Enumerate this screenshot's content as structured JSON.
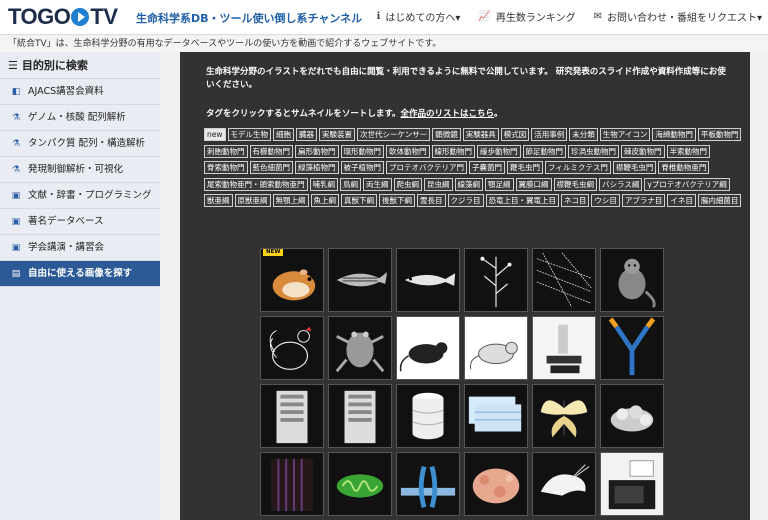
{
  "header": {
    "logo_left": "TOGO",
    "logo_right": "TV",
    "tagline": "生命科学系DB・ツール使い倒し系チャンネル",
    "nav": [
      {
        "icon": "info-icon",
        "label": "はじめての方へ▾"
      },
      {
        "icon": "chart-icon",
        "label": "再生数ランキング"
      },
      {
        "icon": "mail-icon",
        "label": "お問い合わせ・番組をリクエスト▾"
      }
    ]
  },
  "infobar": "「統合TV」は、生命科学分野の有用なデータベースやツールの使い方を動画で紹介するウェブサイトです。",
  "sidebar": {
    "heading": "目的別に検索",
    "items": [
      {
        "icon": "bookmark-icon",
        "label": "AJACS講習会資料"
      },
      {
        "icon": "flask-icon",
        "label": "ゲノム・核酸 配列解析"
      },
      {
        "icon": "flask-icon",
        "label": "タンパク質 配列・構造解析"
      },
      {
        "icon": "flask-icon",
        "label": "発現制御解析・可視化"
      },
      {
        "icon": "book-icon",
        "label": "文献・辞書・プログラミング"
      },
      {
        "icon": "book-icon",
        "label": "著名データベース"
      },
      {
        "icon": "book-icon",
        "label": "学会講演・講習会"
      },
      {
        "icon": "image-icon",
        "label": "自由に使える画像を探す"
      }
    ]
  },
  "main": {
    "intro": "生命科学分野のイラストをだれでも自由に閲覧・利用できるように無料で公開しています。 研究発表のスライド作成や資料作成等にお使いください。",
    "hint_text": "タグをクリックするとサムネイルをソートします。",
    "hint_link": "全作品のリストはこちら",
    "hint_end": "。",
    "tags": [
      "new",
      "モデル生物",
      "細胞",
      "臓器",
      "実験装置",
      "次世代シーケンサー",
      "顕微鏡",
      "実験器具",
      "模式図",
      "活用事例",
      "未分類",
      "生物アイコン",
      "海綿動物門",
      "平板動物門",
      "刺胞動物門",
      "有櫛動物門",
      "扁形動物門",
      "環形動物門",
      "軟体動物門",
      "線形動物門",
      "緩歩動物門",
      "節足動物門",
      "珍渦虫動物門",
      "棘皮動物門",
      "半索動物門",
      "脊索動物門",
      "藍色細菌門",
      "緑藻植物門",
      "被子植物門",
      "プロテオバクテリア門",
      "子嚢菌門",
      "鞭毛虫門",
      "フィルミクテス門",
      "襟鞭毛虫門",
      "脊椎動物亜門",
      "尾索動物亜門・頭索動物亜門",
      "哺乳綱",
      "鳥綱",
      "両生綱",
      "爬虫綱",
      "昆虫綱",
      "線藻綱",
      "顎足綱",
      "翼膜口綱",
      "襟鞭毛虫綱",
      "バシラス綱",
      "γプロテオバクテリア綱",
      "獣亜綱",
      "原獣亜綱",
      "無顎上綱",
      "魚上綱",
      "真獣下綱",
      "後獣下綱",
      "霊長目",
      "クジラ目",
      "恐竜上目・翼竜上目",
      "ネコ目",
      "ウシ目",
      "アブラナ目",
      "イネ目",
      "腸内細菌目"
    ],
    "new_badge": "NEW",
    "thumbs": [
      "hamster",
      "zebrafish",
      "medaka",
      "arabidopsis",
      "fungus",
      "marmoset",
      "chicken",
      "frog",
      "rat",
      "mouse",
      "microscope",
      "antibody",
      "server",
      "server",
      "storage",
      "table",
      "butterfly",
      "protein",
      "sequencer",
      "mitochondria",
      "receptor",
      "organ",
      "shrimp",
      "instrument"
    ]
  }
}
